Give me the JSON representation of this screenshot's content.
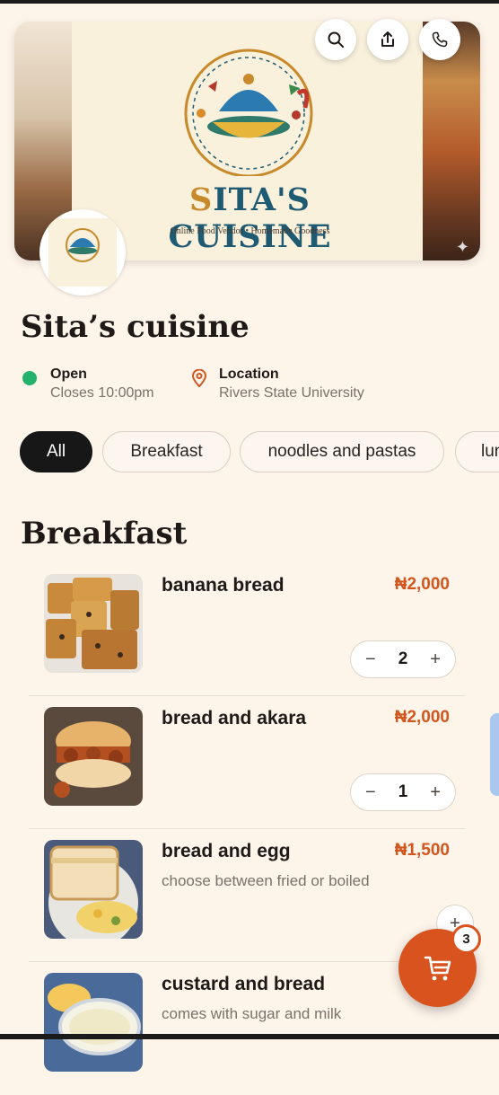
{
  "hero": {
    "brand_first": "S",
    "brand_rest": "ITA'S CUISINE",
    "tagline": "Online Food Vendor • Homemade Goodness",
    "icons": [
      "search-icon",
      "share-icon",
      "phone-icon",
      "sparkle-icon"
    ]
  },
  "store": {
    "name": "Sita’s cuisine",
    "status": "Open",
    "closes": "Closes 10:00pm",
    "location_label": "Location",
    "location_value": "Rivers State University"
  },
  "categories": [
    "All",
    "Breakfast",
    "noodles and pastas",
    "lunch"
  ],
  "active_category": "All",
  "section_title": "Breakfast",
  "items": [
    {
      "name": "banana bread",
      "price": "₦2,000",
      "desc": "",
      "qty": "2"
    },
    {
      "name": "bread and akara",
      "price": "₦2,000",
      "desc": "",
      "qty": "1"
    },
    {
      "name": "bread and egg",
      "price": "₦1,500",
      "desc": "choose between fried or boiled",
      "qty": ""
    },
    {
      "name": "custard and bread",
      "price": "₦",
      "desc": "comes with sugar and milk",
      "qty": ""
    }
  ],
  "stepper": {
    "minus": "−",
    "plus": "+"
  },
  "cart": {
    "count": "3"
  },
  "colors": {
    "accent": "#d9531e",
    "open": "#22b26b",
    "price": "#d2561e",
    "background": "#fdf4ea"
  }
}
